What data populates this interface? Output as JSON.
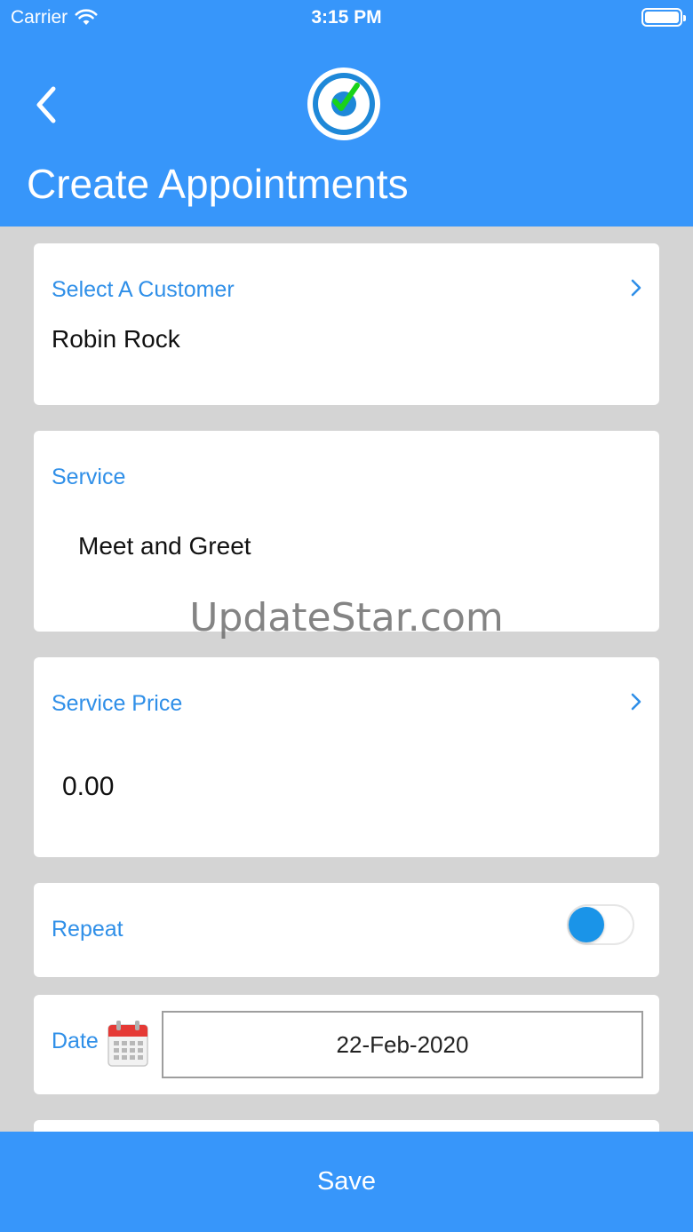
{
  "status_bar": {
    "carrier": "Carrier",
    "time": "3:15 PM"
  },
  "header": {
    "title": "Create Appointments"
  },
  "customer": {
    "label": "Select A Customer",
    "value": "Robin Rock"
  },
  "service": {
    "label": "Service",
    "value": "Meet and Greet"
  },
  "service_price": {
    "label": "Service Price",
    "value": "0.00"
  },
  "repeat": {
    "label": "Repeat",
    "enabled": false
  },
  "date": {
    "label": "Date",
    "value": "22-Feb-2020"
  },
  "watermark": "UpdateStar.com",
  "footer": {
    "save_label": "Save"
  },
  "colors": {
    "brand": "#3796fa",
    "label": "#2f8fe8",
    "toggle_knob": "#1a94e8",
    "background": "#d4d4d4"
  },
  "icons": [
    "wifi-icon",
    "battery-icon",
    "back-chevron-icon",
    "app-logo",
    "chevron-right-icon",
    "calendar-icon"
  ]
}
